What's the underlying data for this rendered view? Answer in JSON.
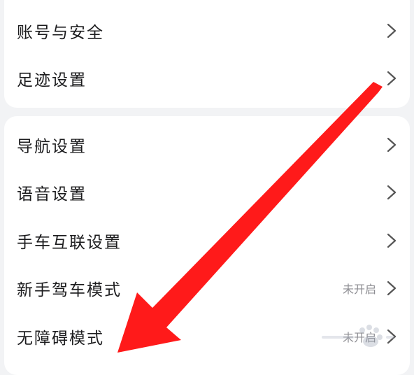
{
  "account_group": {
    "items": [
      {
        "label": "账号与安全",
        "value": ""
      },
      {
        "label": "足迹设置",
        "value": ""
      }
    ]
  },
  "settings_group": {
    "items": [
      {
        "label": "导航设置",
        "value": ""
      },
      {
        "label": "语音设置",
        "value": ""
      },
      {
        "label": "手车互联设置",
        "value": ""
      },
      {
        "label": "新手驾车模式",
        "value": "未开启"
      },
      {
        "label": "无障碍模式",
        "value": "未开启"
      }
    ]
  },
  "icons": {
    "row_chevron": "chevron-right-icon",
    "annotation": "red-arrow-icon"
  },
  "colors": {
    "annotation_arrow": "#ff1a1a",
    "page_background": "#f2f3f5",
    "card_background": "#ffffff",
    "label_text": "#1c1c1e",
    "value_text": "#8e8e93",
    "chevron": "#555555"
  }
}
